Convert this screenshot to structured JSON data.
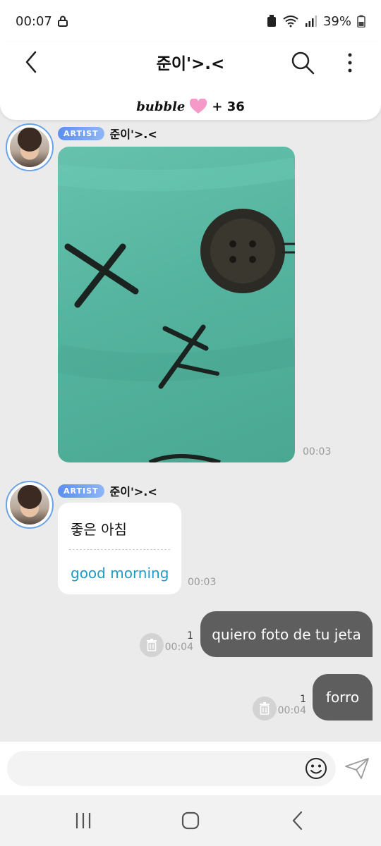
{
  "status_bar": {
    "time": "00:07",
    "battery": "39%"
  },
  "header": {
    "title": "준이'>.<",
    "brand": "bubble",
    "count": "+ 36"
  },
  "messages": [
    {
      "sender_badge": "ARTIST",
      "sender_name": "준이'>.<",
      "type": "photo",
      "time": "00:03"
    },
    {
      "sender_badge": "ARTIST",
      "sender_name": "준이'>.<",
      "type": "text",
      "text": "좋은 아침",
      "translation": "good morning",
      "time": "00:03"
    }
  ],
  "outgoing": [
    {
      "text": "quiero foto de tu jeta",
      "read": "1",
      "time": "00:04"
    },
    {
      "text": "forro",
      "read": "1",
      "time": "00:04"
    }
  ],
  "colors": {
    "accent": "#5b8ff0",
    "outgoing_bubble": "#5e5e5e",
    "translation": "#1d9bc4"
  }
}
